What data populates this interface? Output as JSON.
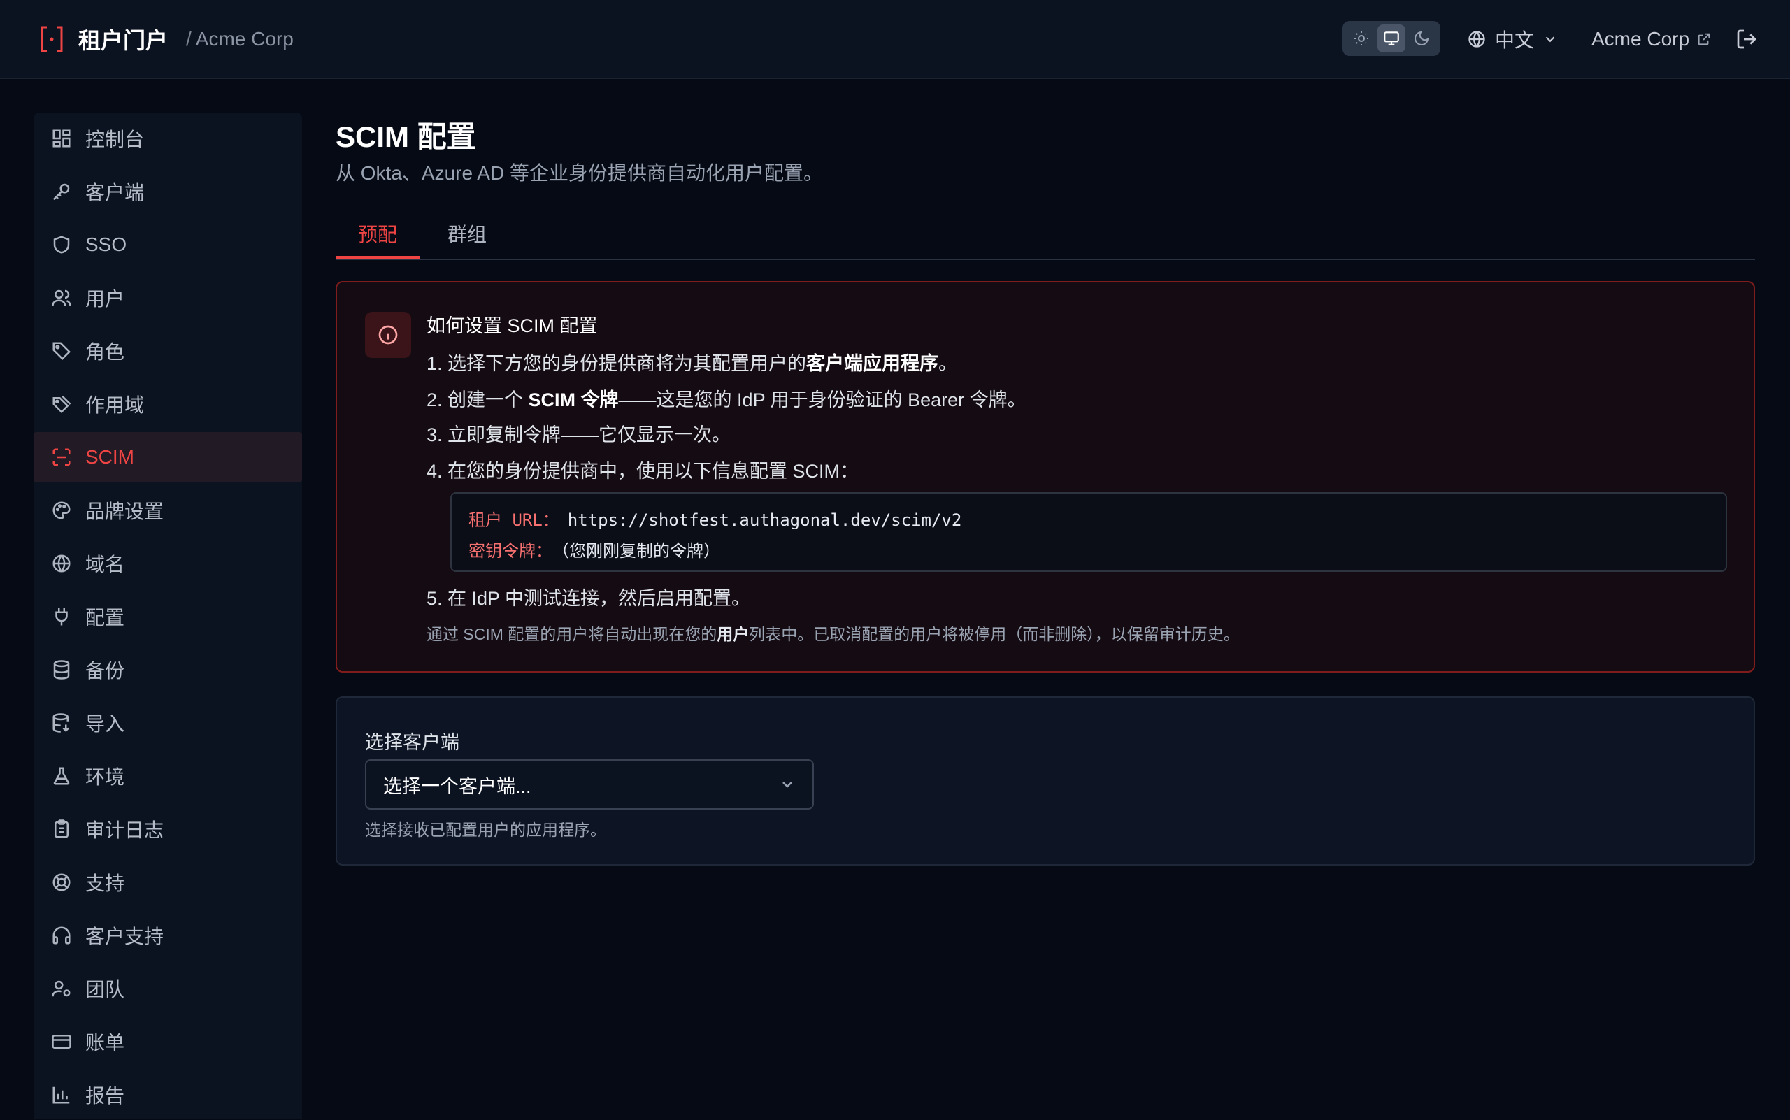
{
  "header": {
    "app_title": "租户门户",
    "separator": "/",
    "tenant": "Acme Corp",
    "language": "中文",
    "account": "Acme Corp"
  },
  "sidebar": {
    "items": [
      {
        "label": "控制台",
        "icon": "dashboard-icon"
      },
      {
        "label": "客户端",
        "icon": "key-icon"
      },
      {
        "label": "SSO",
        "icon": "shield-icon"
      },
      {
        "label": "用户",
        "icon": "users-icon"
      },
      {
        "label": "角色",
        "icon": "tag-icon"
      },
      {
        "label": "作用域",
        "icon": "tags-icon"
      },
      {
        "label": "SCIM",
        "icon": "scan-icon",
        "active": true
      },
      {
        "label": "品牌设置",
        "icon": "palette-icon"
      },
      {
        "label": "域名",
        "icon": "globe-icon"
      },
      {
        "label": "配置",
        "icon": "plug-icon"
      },
      {
        "label": "备份",
        "icon": "database-icon"
      },
      {
        "label": "导入",
        "icon": "database-import-icon"
      },
      {
        "label": "环境",
        "icon": "flask-icon"
      },
      {
        "label": "审计日志",
        "icon": "clipboard-icon"
      },
      {
        "label": "支持",
        "icon": "lifebuoy-icon"
      },
      {
        "label": "客户支持",
        "icon": "headphones-icon"
      },
      {
        "label": "团队",
        "icon": "user-cog-icon"
      },
      {
        "label": "账单",
        "icon": "credit-card-icon"
      },
      {
        "label": "报告",
        "icon": "bar-chart-icon"
      }
    ]
  },
  "page": {
    "title": "SCIM 配置",
    "subtitle": "从 Okta、Azure AD 等企业身份提供商自动化用户配置。"
  },
  "tabs": [
    {
      "label": "预配",
      "active": true
    },
    {
      "label": "群组",
      "active": false
    }
  ],
  "info": {
    "title": "如何设置 SCIM 配置",
    "step1_pre": "1. 选择下方您的身份提供商将为其配置用户的",
    "step1_bold": "客户端应用程序",
    "step1_post": "。",
    "step2_pre": "2. 创建一个 ",
    "step2_bold": "SCIM 令牌",
    "step2_post": "——这是您的 IdP 用于身份验证的 Bearer 令牌。",
    "step3": "3. 立即复制令牌——它仅显示一次。",
    "step4": "4. 在您的身份提供商中，使用以下信息配置 SCIM：",
    "tenant_url_label": "租户 URL：",
    "tenant_url_value": "https://shotfest.authagonal.dev/scim/v2",
    "secret_label": "密钥令牌：",
    "secret_value": "（您刚刚复制的令牌）",
    "step5": "5. 在 IdP 中测试连接，然后启用配置。",
    "note_pre": "通过 SCIM 配置的用户将自动出现在您的",
    "note_bold": "用户",
    "note_post": "列表中。已取消配置的用户将被停用（而非删除），以保留审计历史。"
  },
  "client_select": {
    "label": "选择客户端",
    "placeholder": "选择一个客户端...",
    "help": "选择接收已配置用户的应用程序。"
  },
  "colors": {
    "accent": "#ef4444",
    "background": "#050a14",
    "panel": "#0b1220",
    "info_border": "#7f1d1d"
  }
}
